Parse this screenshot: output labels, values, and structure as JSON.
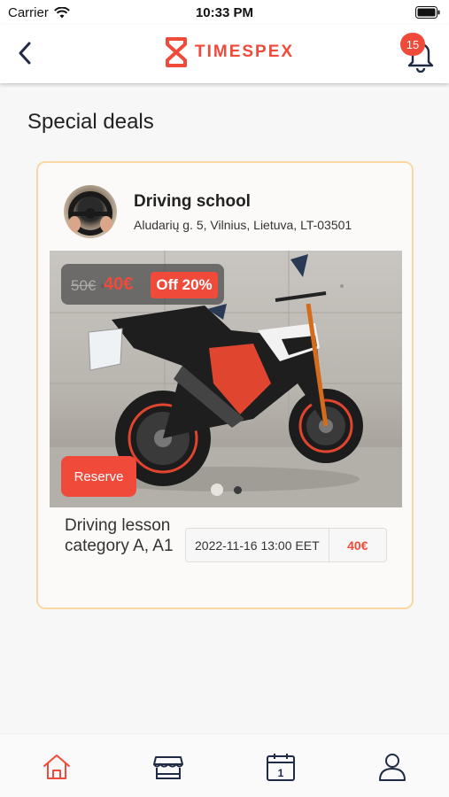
{
  "status_bar": {
    "carrier": "Carrier",
    "time": "10:33 PM",
    "icons": [
      "wifi-icon",
      "battery-icon"
    ]
  },
  "header": {
    "logo_text": "TIMESPEX",
    "notification_count": "15",
    "icons": [
      "back-arrow-icon",
      "timespex-logo-icon",
      "bell-icon"
    ]
  },
  "page": {
    "title": "Special deals"
  },
  "deal": {
    "provider_name": "Driving school",
    "provider_address": "Aludarių g. 5, Vilnius, Lietuva, LT-03501",
    "old_price": "50€",
    "new_price": "40€",
    "discount_label": "Off 20%",
    "reserve_label": "Reserve",
    "carousel": {
      "slide_count": 2,
      "active_slide": 1
    },
    "service_name": "Driving lesson category A, A1",
    "slot_time": "2022-11-16 13:00 EET",
    "slot_price": "40€"
  },
  "tab_bar": {
    "items": [
      {
        "icon": "home-icon",
        "active": true
      },
      {
        "icon": "store-icon",
        "active": false
      },
      {
        "icon": "calendar-icon",
        "active": false,
        "text": "1"
      },
      {
        "icon": "profile-icon",
        "active": false
      }
    ]
  },
  "colors": {
    "accent": "#f04a3a",
    "card_border": "#f8d9a3",
    "icon_dark": "#1f2a44"
  }
}
